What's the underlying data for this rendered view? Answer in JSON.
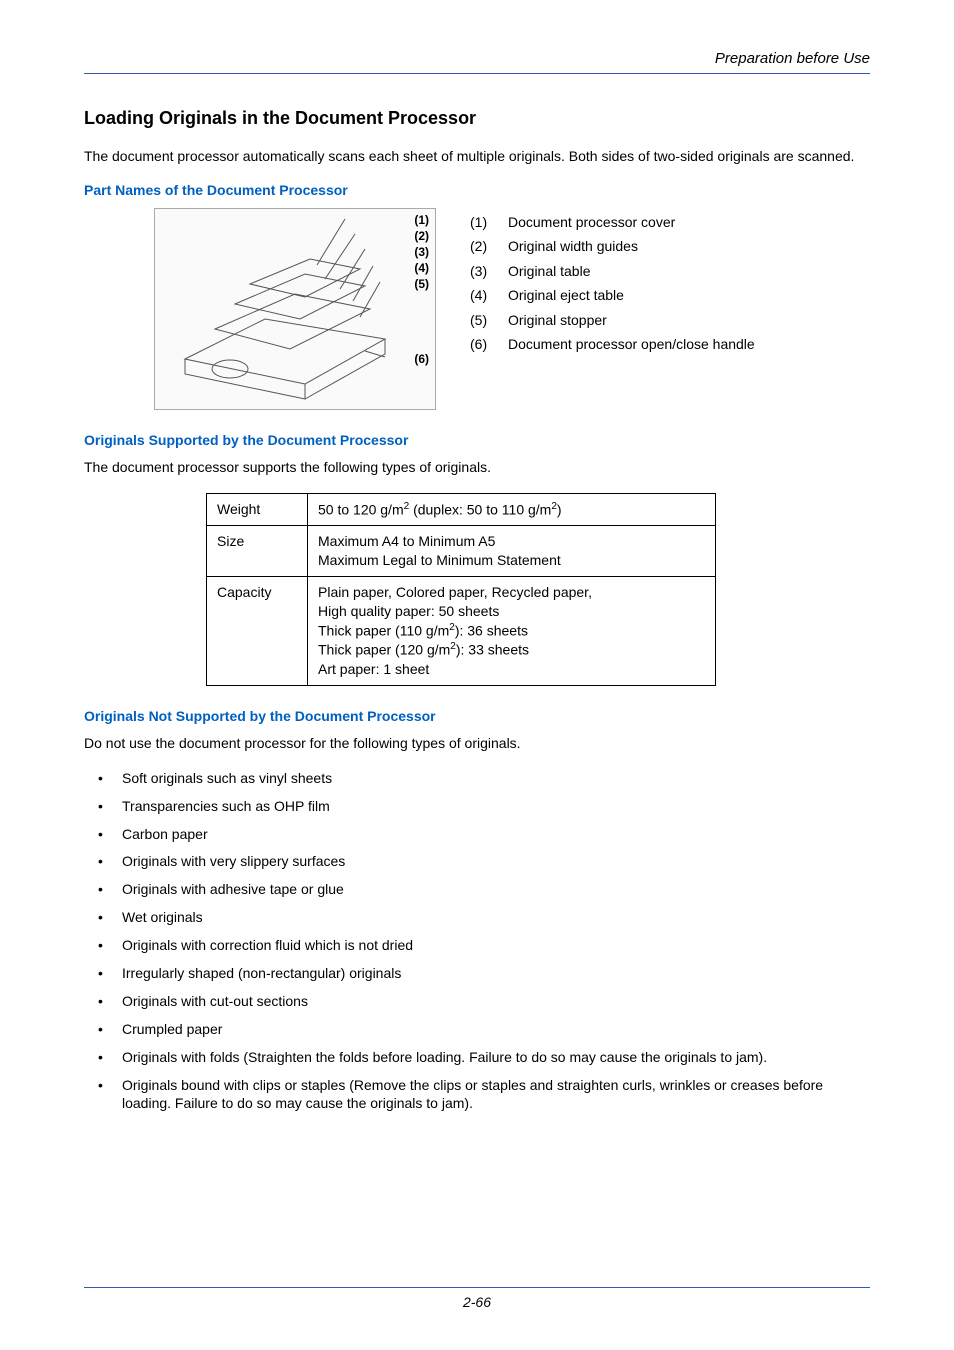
{
  "header": {
    "running": "Preparation before Use"
  },
  "title": "Loading Originals in the Document Processor",
  "intro": "The document processor automatically scans each sheet of multiple originals. Both sides of two-sided originals are scanned.",
  "parts": {
    "heading": "Part Names of the Document Processor",
    "callouts": [
      "(1)",
      "(2)",
      "(3)",
      "(4)",
      "(5)",
      "(6)"
    ],
    "items": [
      {
        "num": "(1)",
        "label": "Document processor cover"
      },
      {
        "num": "(2)",
        "label": "Original width guides"
      },
      {
        "num": "(3)",
        "label": "Original table"
      },
      {
        "num": "(4)",
        "label": "Original eject table"
      },
      {
        "num": "(5)",
        "label": "Original stopper"
      },
      {
        "num": "(6)",
        "label": "Document processor open/close handle"
      }
    ]
  },
  "supported": {
    "heading": "Originals Supported by the Document Processor",
    "intro": "The document processor supports the following types of originals.",
    "table": {
      "weight_label": "Weight",
      "weight_value_a": "50 to 120 g/m",
      "weight_value_b": " (duplex: 50 to 110 g/m",
      "weight_value_c": ")",
      "size_label": "Size",
      "size_line1": "Maximum A4 to Minimum A5",
      "size_line2": "Maximum Legal to Minimum Statement",
      "cap_label": "Capacity",
      "cap_line1": "Plain paper, Colored paper, Recycled paper,",
      "cap_line2": "High quality paper: 50 sheets",
      "cap_line3a": "Thick paper (110 g/m",
      "cap_line3b": "): 36 sheets",
      "cap_line4a": "Thick paper (120 g/m",
      "cap_line4b": "): 33 sheets",
      "cap_line5": "Art paper: 1 sheet"
    }
  },
  "not_supported": {
    "heading": "Originals Not Supported by the Document Processor",
    "intro": "Do not use the document processor for the following types of originals.",
    "items": [
      "Soft originals such as vinyl sheets",
      "Transparencies such as OHP film",
      "Carbon paper",
      "Originals with very slippery surfaces",
      "Originals with adhesive tape or glue",
      "Wet originals",
      "Originals with correction fluid which is not dried",
      "Irregularly shaped (non-rectangular) originals",
      "Originals with cut-out sections",
      "Crumpled paper",
      "Originals with folds (Straighten the folds before loading. Failure to do so may cause the originals to jam).",
      "Originals bound with clips or staples (Remove the clips or staples and straighten curls, wrinkles or creases before loading. Failure to do so may cause the originals to jam)."
    ]
  },
  "footer": {
    "page_num": "2-66"
  },
  "sup2": "2"
}
